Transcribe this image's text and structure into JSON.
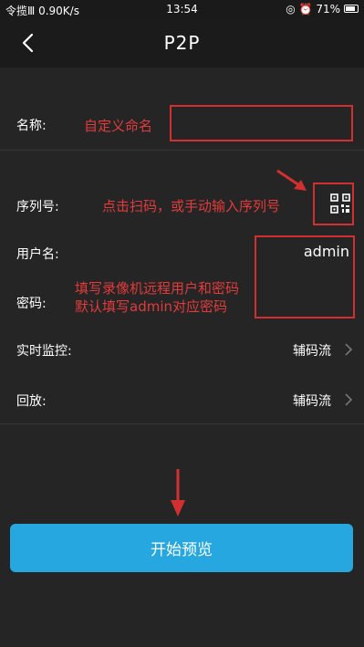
{
  "status_bar": {
    "left": "令揽Ⅲ 0.90K/s",
    "time": "13:54",
    "right": "◎ ⏰ 71%"
  },
  "nav": {
    "title": "P2P"
  },
  "form": {
    "name_label": "名称:",
    "serial_label": "序列号:",
    "username_label": "用户名:",
    "username_value": "admin",
    "password_label": "密码:",
    "live_label": "实时监控:",
    "live_value": "辅码流",
    "playback_label": "回放:",
    "playback_value": "辅码流"
  },
  "annotations": {
    "name_hint": "自定义命名",
    "serial_hint": "点击扫码，或手动输入序列号",
    "cred_hint_1": "填写录像机远程用户和密码",
    "cred_hint_2": "默认填写admin对应密码"
  },
  "start_button": "开始预览",
  "colors": {
    "accent": "#27a7df",
    "annotation": "#d23030",
    "background": "#252525"
  }
}
